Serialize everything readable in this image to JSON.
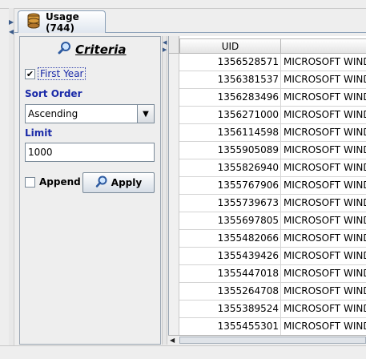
{
  "tab": {
    "label": "Usage (744)",
    "icon": "database-icon"
  },
  "criteria": {
    "title": "Criteria",
    "first_year": {
      "label": "First Year",
      "checked": true
    },
    "sort_order": {
      "label": "Sort Order",
      "selected": "Ascending"
    },
    "limit": {
      "label": "Limit",
      "value": "1000"
    },
    "append": {
      "label": "Append",
      "checked": false
    },
    "apply_label": "Apply"
  },
  "table": {
    "columns": [
      "UID",
      ""
    ],
    "rows": [
      {
        "uid": "1356528571",
        "name": "MICROSOFT WINDO"
      },
      {
        "uid": "1356381537",
        "name": "MICROSOFT WINDO"
      },
      {
        "uid": "1356283496",
        "name": "MICROSOFT WINDO"
      },
      {
        "uid": "1356271000",
        "name": "MICROSOFT WINDO"
      },
      {
        "uid": "1356114598",
        "name": "MICROSOFT WINDO"
      },
      {
        "uid": "1355905089",
        "name": "MICROSOFT WINDO"
      },
      {
        "uid": "1355826940",
        "name": "MICROSOFT WINDO"
      },
      {
        "uid": "1355767906",
        "name": "MICROSOFT WINDO"
      },
      {
        "uid": "1355739673",
        "name": "MICROSOFT WINDO"
      },
      {
        "uid": "1355697805",
        "name": "MICROSOFT WINDO"
      },
      {
        "uid": "1355482066",
        "name": "MICROSOFT WINDO"
      },
      {
        "uid": "1355439426",
        "name": "MICROSOFT WINDO"
      },
      {
        "uid": "1355447018",
        "name": "MICROSOFT WINDO"
      },
      {
        "uid": "1355264708",
        "name": "MICROSOFT WINDO"
      },
      {
        "uid": "1355389524",
        "name": "MICROSOFT WINDO"
      },
      {
        "uid": "1355455301",
        "name": "MICROSOFT WINDO"
      }
    ]
  },
  "colors": {
    "label_blue": "#1a2aa8",
    "border": "#7a8a99"
  }
}
